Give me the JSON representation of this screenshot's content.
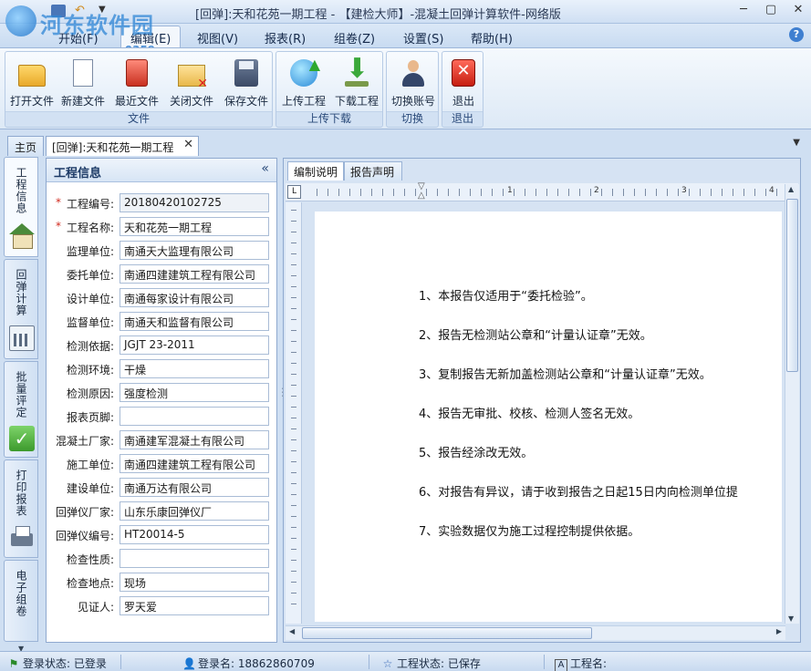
{
  "window": {
    "title": "[回弹]:天和花苑一期工程 - 【建检大师】-混凝土回弹计算软件-网络版",
    "watermark_text": "河东软件园",
    "watermark_url": "www.pc0359.cn"
  },
  "menu": [
    "开始(F)",
    "编辑(E)",
    "视图(V)",
    "报表(R)",
    "组卷(Z)",
    "设置(S)",
    "帮助(H)"
  ],
  "ribbon": {
    "groups": [
      {
        "name": "文件",
        "buttons": [
          "打开文件",
          "新建文件",
          "最近文件",
          "关闭文件",
          "保存文件"
        ]
      },
      {
        "name": "上传下载",
        "buttons": [
          "上传工程",
          "下载工程"
        ]
      },
      {
        "name": "切换",
        "buttons": [
          "切换账号"
        ]
      },
      {
        "name": "退出",
        "buttons": [
          "退出"
        ]
      }
    ]
  },
  "doc_tabs": {
    "home": "主页",
    "project": "[回弹]:天和花苑一期工程"
  },
  "side_tabs": [
    "工程信息",
    "回弹计算",
    "批量评定",
    "打印报表",
    "电子组卷"
  ],
  "info_panel": {
    "title": "工程信息",
    "fields": [
      {
        "label": "工程编号:",
        "value": "20180420102725",
        "required": true
      },
      {
        "label": "工程名称:",
        "value": "天和花苑一期工程",
        "required": true
      },
      {
        "label": "监理单位:",
        "value": "南通天大监理有限公司"
      },
      {
        "label": "委托单位:",
        "value": "南通四建建筑工程有限公司"
      },
      {
        "label": "设计单位:",
        "value": "南通每家设计有限公司"
      },
      {
        "label": "监督单位:",
        "value": "南通天和监督有限公司"
      },
      {
        "label": "检测依据:",
        "value": "JGJT 23-2011"
      },
      {
        "label": "检测环境:",
        "value": "干燥"
      },
      {
        "label": "检测原因:",
        "value": "强度检测"
      },
      {
        "label": "报表页脚:",
        "value": ""
      },
      {
        "label": "混凝土厂家:",
        "value": "南通建军混凝土有限公司"
      },
      {
        "label": "施工单位:",
        "value": "南通四建建筑工程有限公司"
      },
      {
        "label": "建设单位:",
        "value": "南通万达有限公司"
      },
      {
        "label": "回弹仪厂家:",
        "value": "山东乐康回弹仪厂"
      },
      {
        "label": "回弹仪编号:",
        "value": "HT20014-5"
      },
      {
        "label": "检查性质:",
        "value": ""
      },
      {
        "label": "检查地点:",
        "value": "现场"
      },
      {
        "label": "见证人:",
        "value": "罗天爱"
      }
    ]
  },
  "editor": {
    "tabs": [
      "编制说明",
      "报告声明"
    ],
    "ruler_numbers": [
      "1",
      "2",
      "3",
      "4"
    ],
    "lines": [
      "1、本报告仅适用于“委托检验”。",
      "2、报告无检测站公章和“计量认证章”无效。",
      "3、复制报告无新加盖检测站公章和“计量认证章”无效。",
      "4、报告无审批、校核、检测人签名无效。",
      "5、报告经涂改无效。",
      "6、对报告有异议，请于收到报告之日起15日内向检测单位提",
      "7、实验数据仅为施工过程控制提供依据。"
    ]
  },
  "status": {
    "login_state": "登录状态: 已登录",
    "login_name": "登录名: 18862860709",
    "project_state": "工程状态: 已保存",
    "project_name": "工程名:"
  }
}
